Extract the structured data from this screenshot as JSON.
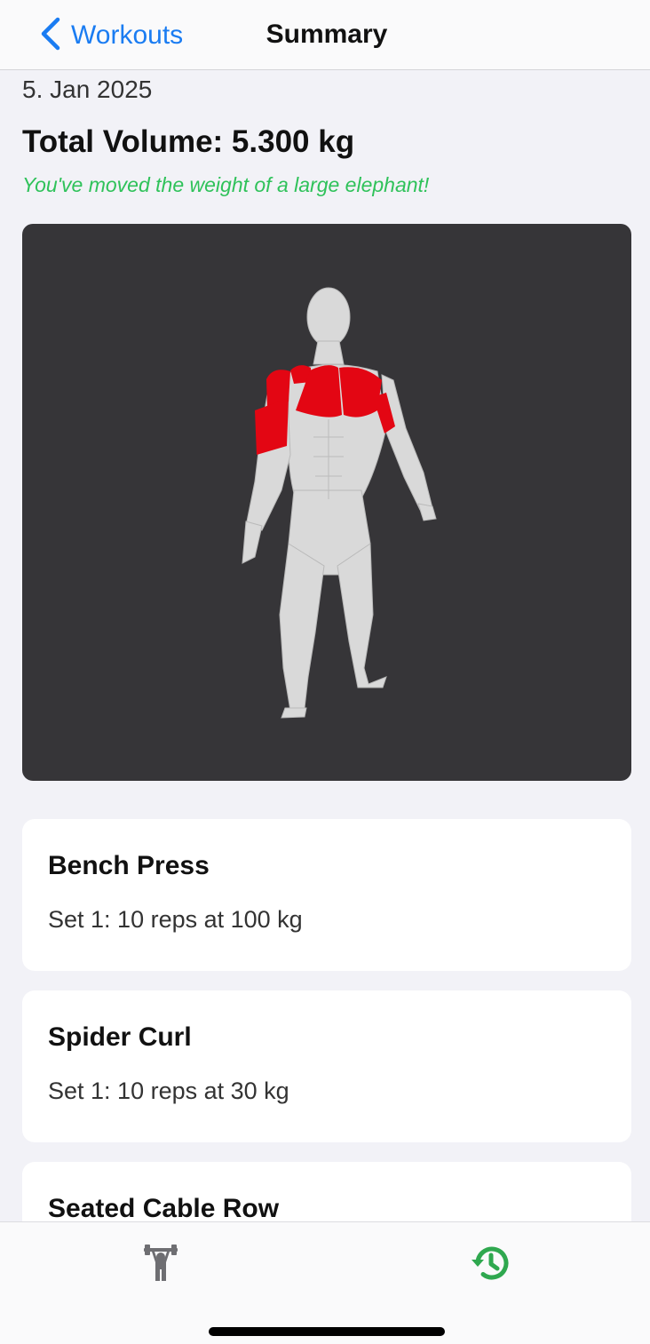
{
  "nav": {
    "back_label": "Workouts",
    "title": "Summary"
  },
  "summary": {
    "date": "5. Jan 2025",
    "total_volume": "Total Volume: 5.300 kg",
    "motivation": "You've moved the weight of a large elephant!"
  },
  "muscle_viewer": {
    "background_color": "#363538",
    "highlight_color": "#e30613",
    "highlighted_muscles": [
      "chest",
      "front-delts",
      "biceps"
    ]
  },
  "exercises": [
    {
      "name": "Bench Press",
      "sets": [
        "Set 1: 10 reps at 100 kg"
      ]
    },
    {
      "name": "Spider Curl",
      "sets": [
        "Set 1: 10 reps at 30 kg"
      ]
    },
    {
      "name": "Seated Cable Row",
      "sets": []
    }
  ],
  "tabbar": {
    "tabs": [
      {
        "icon": "weightlifter-icon",
        "active": false,
        "color": "#6e6e72"
      },
      {
        "icon": "history-icon",
        "active": true,
        "color": "#2fa84f"
      }
    ]
  }
}
